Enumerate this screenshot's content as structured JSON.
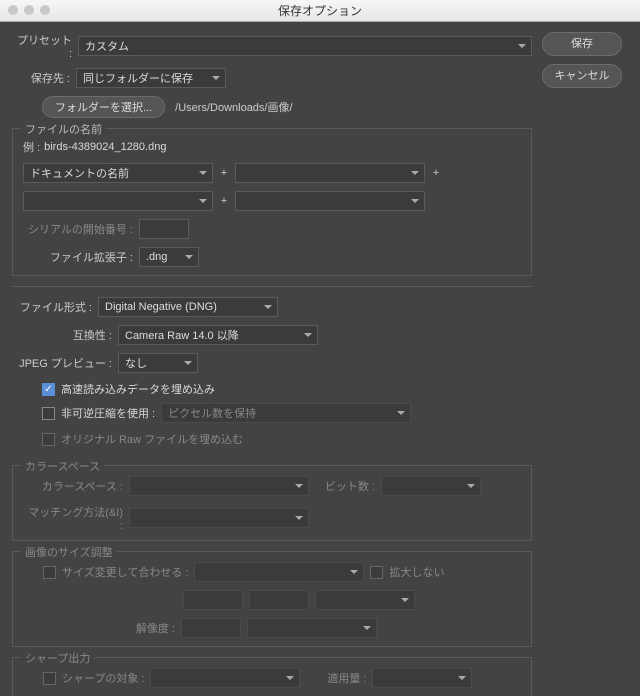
{
  "window": {
    "title": "保存オプション"
  },
  "actions": {
    "save": "保存",
    "cancel": "キャンセル"
  },
  "preset": {
    "label": "プリセット :",
    "value": "カスタム"
  },
  "destination": {
    "label": "保存先 :",
    "value": "同じフォルダーに保存",
    "chooseFolder": "フォルダーを選択...",
    "path": "/Users/Downloads/画像/"
  },
  "filename": {
    "group": "ファイルの名前",
    "exampleLabel": "例 :",
    "exampleValue": "birds-4389024_1280.dng",
    "part1": "ドキュメントの名前",
    "serialLabel": "シリアルの開始番号 :",
    "extLabel": "ファイル拡張子 :",
    "extValue": ".dng"
  },
  "format": {
    "label": "ファイル形式 :",
    "value": "Digital Negative (DNG)",
    "compatLabel": "互換性 :",
    "compatValue": "Camera Raw 14.0 以降",
    "jpegPreviewLabel": "JPEG プレビュー :",
    "jpegPreviewValue": "なし",
    "embedFast": "高速読み込みデータを埋め込み",
    "losslessLabel": "非可逆圧縮を使用 :",
    "losslessValue": "ピクセル数を保持",
    "embedRaw": "オリジナル Raw ファイルを埋め込む"
  },
  "color": {
    "group": "カラースペース",
    "spaceLabel": "カラースペース :",
    "bitLabel": "ビット数 :",
    "intentLabel": "マッチング方法(&I) :"
  },
  "resize": {
    "group": "画像のサイズ調整",
    "fitLabel": "サイズ変更して合わせる :",
    "noScale": "拡大しない",
    "resLabel": "解像度 :"
  },
  "sharpen": {
    "group": "シャープ出力",
    "targetLabel": "シャープの対象 :",
    "amountLabel": "適用量 :"
  }
}
